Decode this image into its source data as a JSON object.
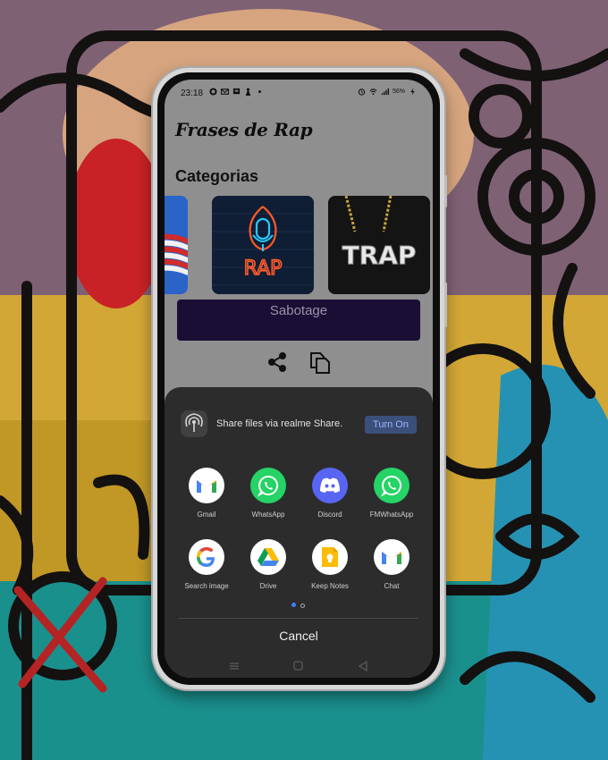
{
  "status_bar": {
    "time": "23:18",
    "battery": "56%",
    "left_icons": [
      "whatsapp-icon",
      "mail-icon",
      "message-icon",
      "person-icon",
      "dot-icon"
    ],
    "right_icons": [
      "alarm-icon",
      "wifi-icon",
      "signal-icon",
      "battery-icon"
    ]
  },
  "app": {
    "title": "Frases de Rap",
    "section_title": "Categorias",
    "categories": [
      {
        "label": "",
        "image": "flag"
      },
      {
        "label": "RAP",
        "image": "rap-neon"
      },
      {
        "label": "TRAP",
        "image": "trap-chain"
      }
    ],
    "now_playing": "Sabotage",
    "actions": [
      "share-icon",
      "copy-icon"
    ]
  },
  "share_sheet": {
    "realme_text": "Share files via realme Share.",
    "turn_on_label": "Turn On",
    "apps": [
      {
        "label": "Gmail",
        "icon": "gmail-icon"
      },
      {
        "label": "WhatsApp",
        "icon": "whatsapp-icon"
      },
      {
        "label": "Discord",
        "icon": "discord-icon"
      },
      {
        "label": "FMWhatsApp",
        "icon": "fmwhatsapp-icon"
      },
      {
        "label": "Search image",
        "icon": "google-icon"
      },
      {
        "label": "Drive",
        "icon": "drive-icon"
      },
      {
        "label": "Keep Notes",
        "icon": "keep-notes-icon"
      },
      {
        "label": "Chat",
        "icon": "gmail-chat-icon"
      }
    ],
    "page_indicator": {
      "pages": 2,
      "current": 1
    },
    "cancel_label": "Cancel"
  },
  "colors": {
    "accent": "#3b82f6",
    "sheet_bg": "#2c2c2c",
    "now_playing_bg": "#1b0e35",
    "whatsapp": "#25d366",
    "discord": "#5865f2"
  }
}
